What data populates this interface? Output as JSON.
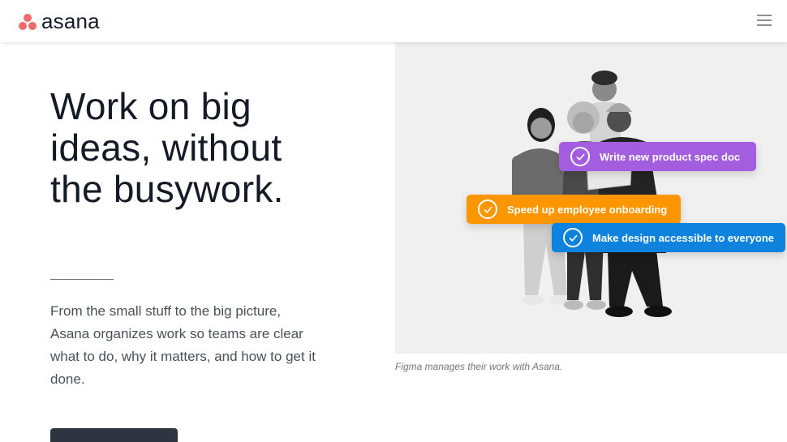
{
  "header": {
    "logo_text": "asana",
    "logo_color": "#f06a6a"
  },
  "hero": {
    "headline_lines": [
      "Work on big",
      "ideas, without",
      "the busywork."
    ],
    "body_lines": [
      "From the small stuff to the big picture,",
      "Asana organizes work so teams are clear",
      "what to do, why it matters, and how to get it",
      "done."
    ]
  },
  "image": {
    "caption": "Figma manages their work with Asana.",
    "tasks": [
      {
        "label": "Write new product spec doc",
        "color": "#a35ee0"
      },
      {
        "label": "Speed up employee onboarding",
        "color": "#fc9600"
      },
      {
        "label": "Make design accessible to everyone",
        "color": "#0d83dd"
      }
    ]
  },
  "icons": {
    "menu": "hamburger-menu-icon",
    "check": "check-circle-icon"
  }
}
